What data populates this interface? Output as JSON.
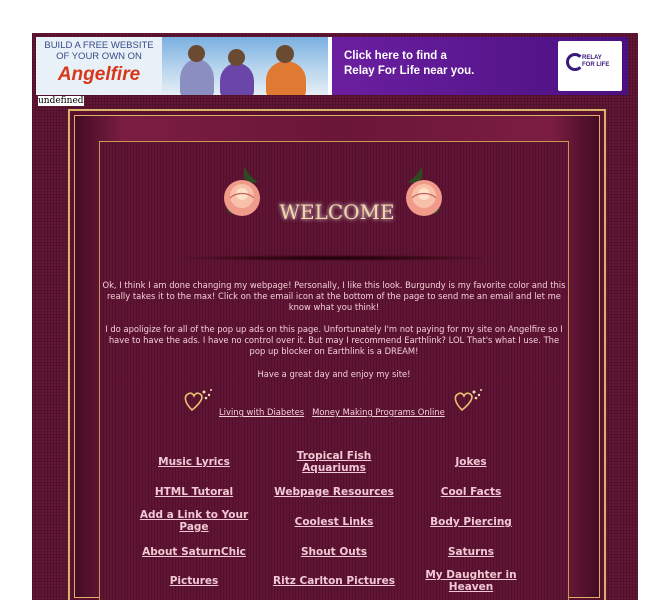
{
  "banner": {
    "angelfire": {
      "line1": "BUILD A FREE WEBSITE",
      "line2": "OF YOUR OWN ON",
      "logo": "Angelfire"
    },
    "relay": {
      "cta_line1": "Click here to find a",
      "cta_line2": "Relay For Life near you.",
      "logo_line1": "RELAY",
      "logo_line2": "FOR LIFE"
    }
  },
  "undefined_text": "undefined",
  "welcome_title": "WELCOME",
  "paragraphs": [
    "Ok, I think I am done changing my webpage! Personally, I like this look. Burgundy is my favorite color and this really takes it to the max! Click on the email icon at the bottom of the page to send me an email and let me know what you think!",
    "I do apoligize for all of the pop up ads on this page. Unfortunately I'm not paying for my site on Angelfire so I have to have the ads. I have no control over it. But may I recommend Earthlink? LOL That's what I use. The pop up blocker on Earthlink is a DREAM!",
    "Have a great day and enjoy my site!"
  ],
  "featured_links": [
    "Living with Diabetes",
    "Money Making Programs Online"
  ],
  "nav_links": [
    "Music Lyrics",
    "Tropical Fish Aquariums",
    "Jokes",
    "HTML Tutoral",
    "Webpage Resources",
    "Cool Facts",
    "Add a Link to Your Page",
    "Coolest Links",
    "Body Piercing",
    "About SaturnChic",
    "Shout Outs",
    "Saturns",
    "Pictures",
    "Ritz Carlton Pictures",
    "My Daughter in Heaven"
  ],
  "colors": {
    "page_bg": "#5a0f2e",
    "gold": "#d9b368",
    "text": "#f3cfd7"
  }
}
